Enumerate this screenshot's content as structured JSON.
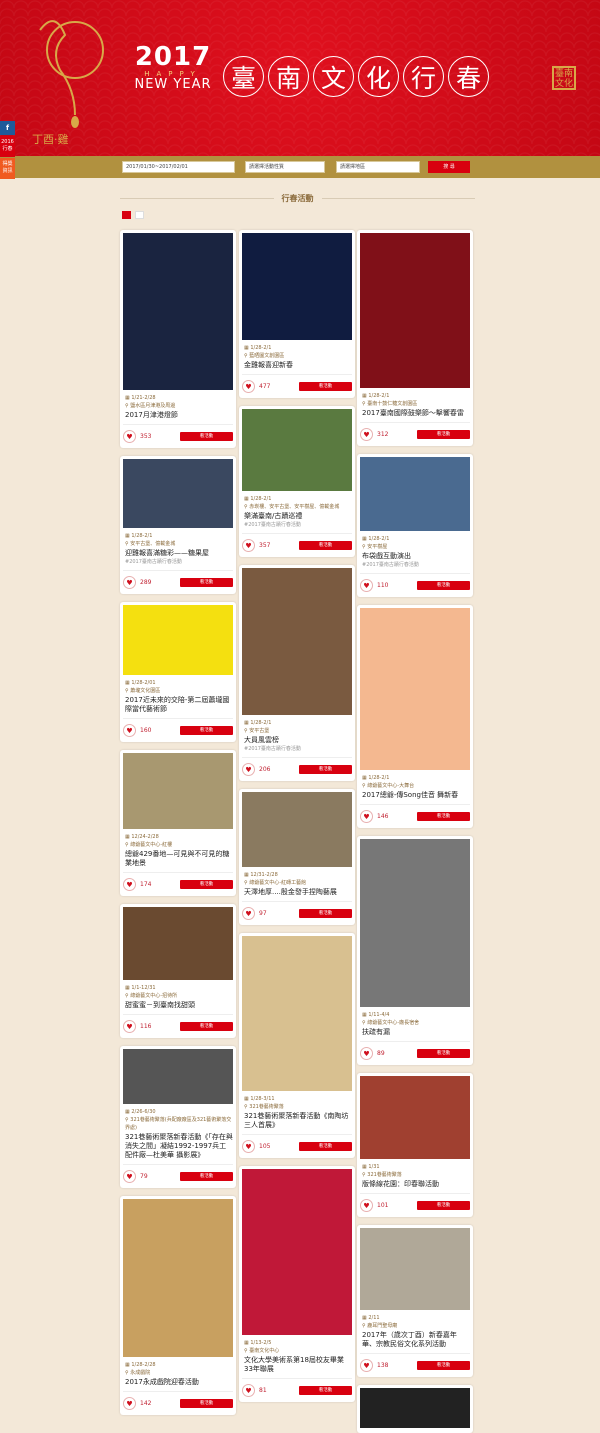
{
  "header": {
    "year": "2017",
    "happy": "HAPPY",
    "new_year": "NEW YEAR",
    "title_chars": [
      "臺",
      "南",
      "文",
      "化",
      "行",
      "春"
    ],
    "seal": "臺南文化",
    "logo_text": "丁酉·雞"
  },
  "side": {
    "facebook": "f",
    "tab1": "2016行春",
    "tab2": "得獎資訊"
  },
  "search": {
    "date": "2017/01/30~2017/02/01",
    "type": "請選擇活動性質",
    "area": "請選擇地區",
    "button": "搜 尋"
  },
  "section_title": "行春活動",
  "button_label": "看活動",
  "columns": [
    [
      {
        "date": "1/21-2/28",
        "loc": "鹽水區月津港及周邊",
        "title": "2017月津港燈節",
        "likes": "353",
        "img": "#1a2440"
      },
      {
        "date": "1/28-2/1",
        "loc": "安平古堡、億載金城",
        "title": "迎雞報喜滿糖彩——糖果屋",
        "tag": "#2017臺南古蹟行春活動",
        "likes": "289",
        "img": "#3a4860"
      },
      {
        "date": "1/28-2/01",
        "loc": "蕭壠文化園區",
        "title": "2017近未來的交陪-第二屆蕭壠國際當代藝術節",
        "likes": "160",
        "img": "#f4e010"
      },
      {
        "date": "12/24-2/28",
        "loc": "總爺藝文中心-紅樓",
        "title": "總爺429番地—可見與不可見的糖業地景",
        "likes": "174",
        "img": "#a89870"
      },
      {
        "date": "1/1-12/31",
        "loc": "總爺藝文中心-招待所",
        "title": "甜蜜蜜－到臺南找甜頭",
        "likes": "116",
        "img": "#6a4a30"
      },
      {
        "date": "2/26-6/30",
        "loc": "321巷藝術聚落(兵配廠廠區及321藝術聚落交界處)",
        "title": "321巷藝術聚落新春活動《「存在與消失之間」凝結1992-1997兵工配件廠—杜美華 攝影展》",
        "likes": "79",
        "img": "#555"
      },
      {
        "date": "1/28-2/28",
        "loc": "永成戲院",
        "title": "2017永成戲院迎春活動",
        "likes": "142",
        "img": "#c8a060"
      }
    ],
    [
      {
        "date": "1/28-2/1",
        "loc": "藍晒圖文創園區",
        "title": "金雞報喜迎新春",
        "likes": "477",
        "img": "#101c40"
      },
      {
        "date": "1/28-2/1",
        "loc": "赤崁樓、安平古堡、安平樹屋、億載金城",
        "title": "樂滿臺南/古蹟巡禮",
        "tag": "#2017臺南古蹟行春活動",
        "likes": "357",
        "img": "#5a7a40"
      },
      {
        "date": "1/28-2/1",
        "loc": "安平古堡",
        "title": "大員風雲榜",
        "tag": "#2017臺南古蹟行春活動",
        "likes": "206",
        "img": "#7a5a40"
      },
      {
        "date": "12/31-2/28",
        "loc": "總爺藝文中心-紅磚工藝館",
        "title": "天澤地厚....殷金發手捏陶藝展",
        "likes": "97",
        "img": "#8a7a60"
      },
      {
        "date": "1/28-3/11",
        "loc": "321巷藝術聚落",
        "title": "321巷藝術聚落新春活動《南陶坊三人首展》",
        "likes": "105",
        "img": "#d8c090"
      },
      {
        "date": "1/13-2/5",
        "loc": "臺南文化中心",
        "title": "文化大學美術系第18屆校友畢業33年聯展",
        "likes": "81",
        "img": "#c01838"
      }
    ],
    [
      {
        "date": "1/28-2/1",
        "loc": "臺南十鼓仁糖文創園區",
        "title": "2017臺南國際鼓樂節～擊響春雷",
        "likes": "312",
        "img": "#801018"
      },
      {
        "date": "1/28-2/1",
        "loc": "安平樹屋",
        "title": "布袋戲互動演出",
        "tag": "#2017臺南古蹟行春活動",
        "likes": "110",
        "img": "#4a6a90"
      },
      {
        "date": "1/28-2/1",
        "loc": "總爺藝文中心-大舞台",
        "title": "2017總爺-傳Song佳音 舞新春",
        "likes": "146",
        "img": "#f4b890"
      },
      {
        "date": "1/11-4/4",
        "loc": "總爺藝文中心-廠長宿舍",
        "title": "扶疏有漏",
        "likes": "89",
        "img": "#777"
      },
      {
        "date": "1/31",
        "loc": "321巷藝術聚落",
        "title": "版條線花園：印春聯活動",
        "likes": "101",
        "img": "#a04030"
      },
      {
        "date": "2/11",
        "loc": "鹿耳門聖母廟",
        "title": "2017年（歲次丁酉）新春嘉年華、宗教民俗文化系列活動",
        "likes": "138",
        "img": "#b0a898"
      },
      {
        "date": "",
        "loc": "",
        "title": "",
        "likes": "",
        "img": "#222",
        "partial": true
      }
    ]
  ]
}
